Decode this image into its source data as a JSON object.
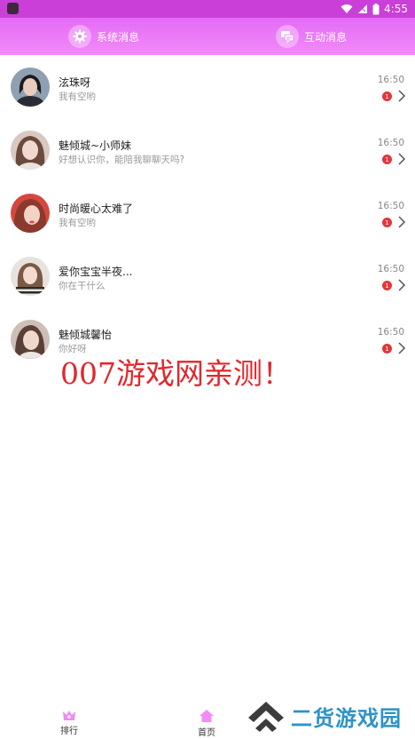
{
  "status_bar": {
    "time": "4:55"
  },
  "top_tabs": [
    {
      "label": "系统消息",
      "icon": "gear-icon"
    },
    {
      "label": "互动消息",
      "icon": "chat-bubbles-icon"
    }
  ],
  "messages": [
    {
      "name": "泫珠呀",
      "preview": "我有空哟",
      "time": "16:50",
      "unread": "1"
    },
    {
      "name": "魅倾城~小师妹",
      "preview": "好想认识你，能陪我聊聊天吗?",
      "time": "16:50",
      "unread": "1"
    },
    {
      "name": "时尚暖心太难了",
      "preview": "我有空哟",
      "time": "16:50",
      "unread": "1"
    },
    {
      "name": "爱你宝宝半夜...",
      "preview": "你在干什么",
      "time": "16:50",
      "unread": "1"
    },
    {
      "name": "魅倾城馨怡",
      "preview": "你好呀",
      "time": "16:50",
      "unread": "1"
    }
  ],
  "watermarks": {
    "red_text": "007游戏网亲测！",
    "logo_text": "二货游戏园"
  },
  "bottom_nav": [
    {
      "label": "排行",
      "icon": "ranking-icon"
    },
    {
      "label": "首页",
      "icon": "home-icon"
    }
  ],
  "colors": {
    "header": "#e46bf6",
    "accent": "#c93fd8",
    "badge": "#e5363b",
    "watermark": "#e0282e",
    "logo": "#2d93c7"
  }
}
